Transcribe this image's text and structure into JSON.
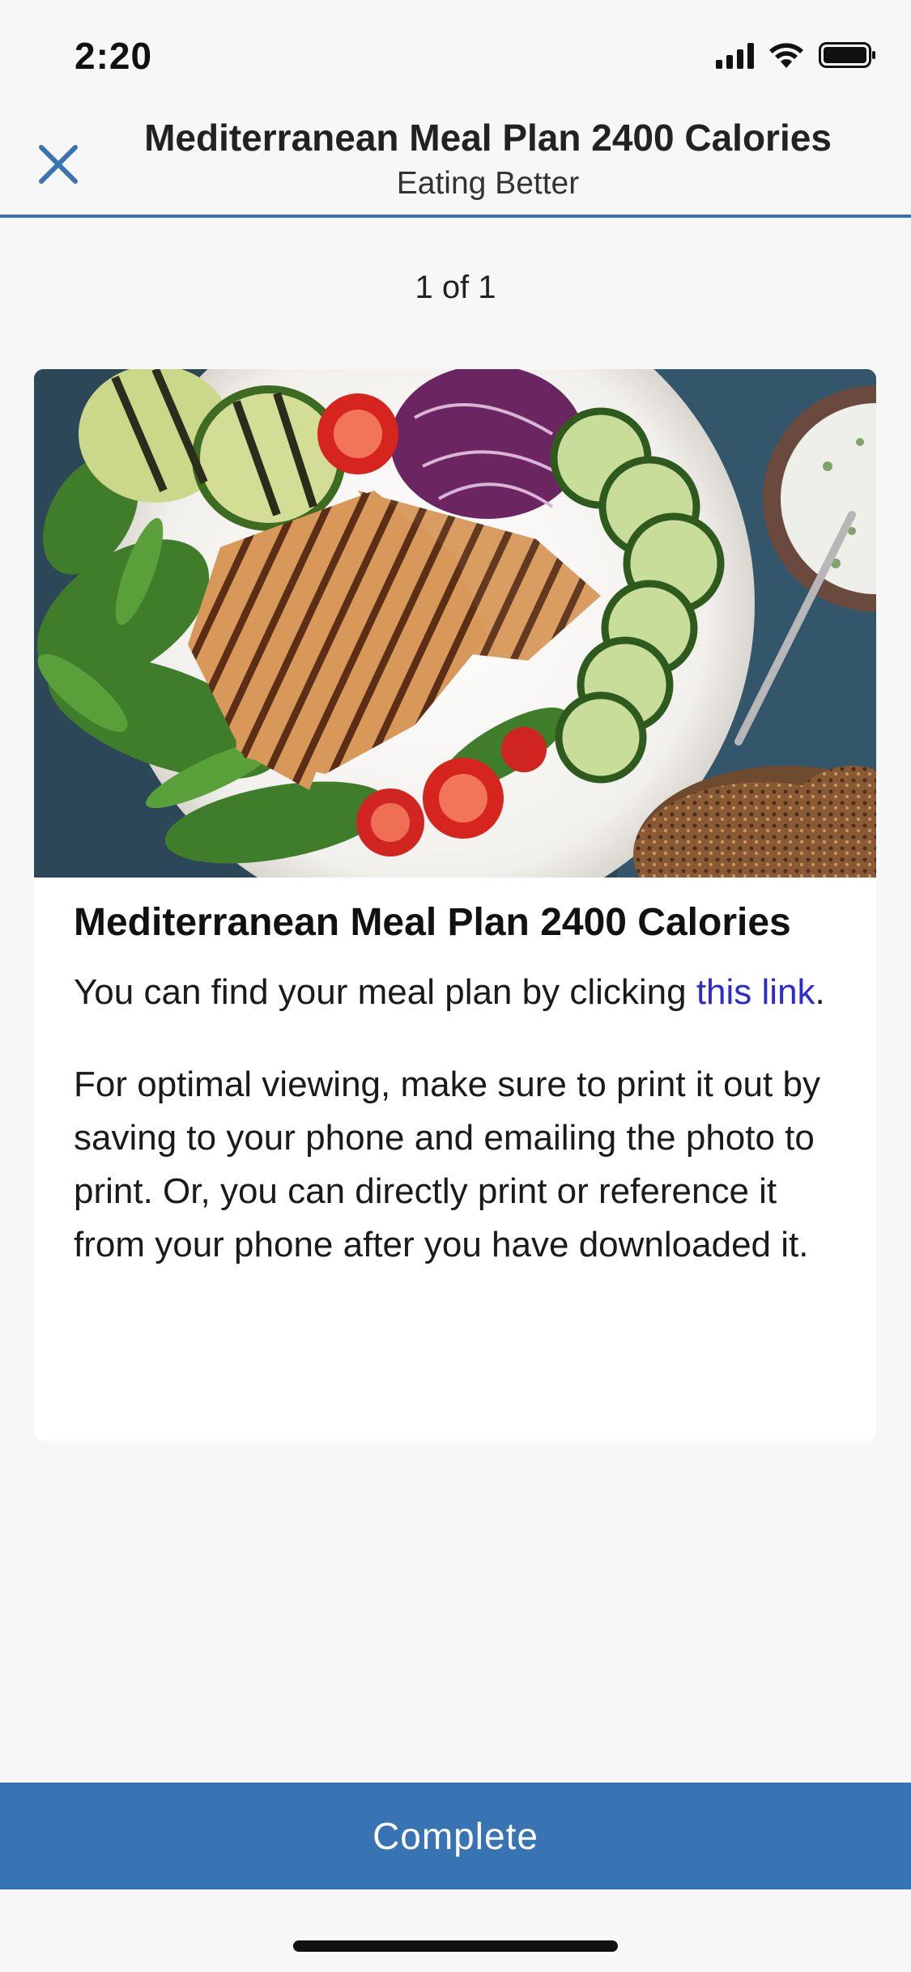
{
  "status_bar": {
    "time": "2:20",
    "icons": [
      "signal-icon",
      "wifi-icon",
      "battery-icon"
    ]
  },
  "header": {
    "title": "Mediterranean Meal Plan 2400 Calories",
    "subtitle": "Eating Better",
    "close_icon": "close-icon",
    "accent_color": "#3974b2"
  },
  "pager": {
    "text": "1 of 1"
  },
  "card": {
    "image_icon": "food-photo",
    "title": "Mediterranean Meal Plan 2400 Calories",
    "paragraph1_prefix": "You can find your meal plan by clicking ",
    "paragraph1_link": "this link",
    "paragraph1_suffix": ".",
    "paragraph2": "For optimal viewing, make sure to print it out by saving to your phone and emailing the photo to print. Or, you can directly print or reference it from your phone after you have downloaded it.",
    "link_color": "#2a2bd0"
  },
  "footer": {
    "complete_label": "Complete",
    "button_color": "#3873b4"
  }
}
